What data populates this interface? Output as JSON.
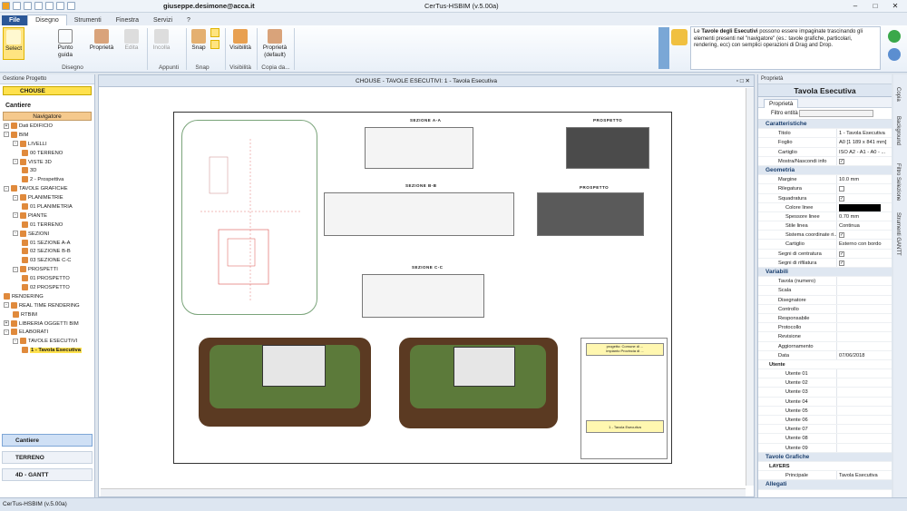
{
  "app": {
    "user": "giuseppe.desimone@acca.it",
    "title": "CerTus-HSBIM (v.5.00a)",
    "status": "CerTus-HSBIM (v.5.00a)"
  },
  "tabs": [
    "File",
    "Disegno",
    "Strumenti",
    "Finestra",
    "Servizi",
    "?"
  ],
  "ribbon": {
    "select": "Select",
    "punto": "Punto\nguida",
    "proprieta": "Proprietà",
    "edita": "Edita",
    "incolla": "Incolla",
    "snap": "Snap",
    "visibilita": "Visibilità",
    "prop_default": "Proprietà\n(default)",
    "groups": {
      "disegno": "Disegno",
      "appunti": "Appunti",
      "snap": "Snap",
      "visibilita": "Visibilità",
      "copia": "Copia da..."
    }
  },
  "help": {
    "pre": "Le ",
    "bold": "Tavole degli Esecutivi",
    "post": " possono essere impaginate trascinando gli elementi presenti nel \"navigatore\" (es.: tavole grafiche, particolari, rendering, ecc) con semplici operazioni di Drag and Drop."
  },
  "left": {
    "header": "Gestione Progetto",
    "project": "CHOUSE",
    "cantiere": "Cantiere",
    "navigatore": "Navigatore",
    "tree": [
      {
        "t": "Dati EDIFICIO",
        "l": 0,
        "g": "+"
      },
      {
        "t": "BIM",
        "l": 0,
        "g": "-"
      },
      {
        "t": "LIVELLI",
        "l": 1,
        "g": "-"
      },
      {
        "t": "00 TERRENO",
        "l": 2,
        "g": ""
      },
      {
        "t": "VISTE 3D",
        "l": 1,
        "g": "-"
      },
      {
        "t": "3D",
        "l": 2,
        "g": ""
      },
      {
        "t": "2 - Prospettiva",
        "l": 2,
        "g": ""
      },
      {
        "t": "TAVOLE GRAFICHE",
        "l": 0,
        "g": "-"
      },
      {
        "t": "PLANIMETRIE",
        "l": 1,
        "g": "-"
      },
      {
        "t": "01 PLANIMETRIA",
        "l": 2,
        "g": ""
      },
      {
        "t": "PIANTE",
        "l": 1,
        "g": "-"
      },
      {
        "t": "01 TERRENO",
        "l": 2,
        "g": ""
      },
      {
        "t": "SEZIONI",
        "l": 1,
        "g": "-"
      },
      {
        "t": "01 SEZIONE  A-A",
        "l": 2,
        "g": ""
      },
      {
        "t": "02 SEZIONE  B-B",
        "l": 2,
        "g": ""
      },
      {
        "t": "03 SEZIONE  C-C",
        "l": 2,
        "g": ""
      },
      {
        "t": "PROSPETTI",
        "l": 1,
        "g": "-"
      },
      {
        "t": "01 PROSPETTO",
        "l": 2,
        "g": ""
      },
      {
        "t": "02 PROSPETTO",
        "l": 2,
        "g": ""
      },
      {
        "t": "RENDERING",
        "l": 0,
        "g": ""
      },
      {
        "t": "REAL TIME RENDERING",
        "l": 0,
        "g": "-"
      },
      {
        "t": "RTBIM",
        "l": 1,
        "g": ""
      },
      {
        "t": "LIBRERIA OGGETTI BIM",
        "l": 0,
        "g": "+"
      },
      {
        "t": "ELABORATI",
        "l": 0,
        "g": "-"
      },
      {
        "t": "TAVOLE ESECUTIVI",
        "l": 1,
        "g": "-"
      },
      {
        "t": "1 - Tavola Esecutiva",
        "l": 2,
        "g": "",
        "sel": true
      }
    ],
    "nav": [
      "Cantiere",
      "TERRENO",
      "4D - GANTT"
    ]
  },
  "doc": {
    "title": "CHOUSE - TAVOLE ESECUTIVI: 1 - Tavola Esecutiva",
    "labels": {
      "sa": "SEZIONE A-A",
      "sb": "SEZIONE B-B",
      "sc": "SEZIONE C-C",
      "p1": "PROSPETTO",
      "p2": "PROSPETTO"
    },
    "cartiglio": {
      "top": "progetto: Comune di ...\nimpianto Provincia di ...",
      "mid": "1 - Tavola Esecutiva"
    }
  },
  "props": {
    "header": "Proprietà",
    "title": "Tavola Esecutiva",
    "tab": "Proprietà",
    "filtro": "Filtro entità",
    "rows": [
      {
        "c": "cat",
        "k": "Caratteristiche"
      },
      {
        "k": "Titolo",
        "v": "1 - Tavola Esecutiva"
      },
      {
        "k": "Foglio",
        "v": "A0 [1 189 x 841 mm]"
      },
      {
        "k": "Cartiglio",
        "v": "ISO  A2 - A1 - A0 - ..."
      },
      {
        "k": "Mostra/Nascondi info",
        "cb": true
      },
      {
        "c": "cat",
        "k": "Geometria"
      },
      {
        "k": "Margine",
        "v": "10.0 mm"
      },
      {
        "k": "Rilegatura",
        "cb": false
      },
      {
        "k": "Squadratura",
        "cb": true,
        "c": "sub2"
      },
      {
        "c": "ind",
        "k": "Colore linee",
        "sw": true
      },
      {
        "c": "ind",
        "k": "Spessore linee",
        "v": "0.70 mm"
      },
      {
        "c": "ind",
        "k": "Stile linea",
        "v": "Continua"
      },
      {
        "c": "ind",
        "k": "Sistema coordinate ri...",
        "cb": true
      },
      {
        "c": "ind",
        "k": "Cartiglio",
        "v": "Esterno con bordo"
      },
      {
        "k": "Segni di centratura",
        "cb": true
      },
      {
        "k": "Segni di rifilatura",
        "cb": true
      },
      {
        "c": "cat",
        "k": "Variabili"
      },
      {
        "k": "Tavola (numero)",
        "v": ""
      },
      {
        "k": "Scala",
        "v": ""
      },
      {
        "k": "Disegnatore",
        "v": ""
      },
      {
        "k": "Controllo",
        "v": ""
      },
      {
        "k": "Responsabile",
        "v": ""
      },
      {
        "k": "Protocollo",
        "v": ""
      },
      {
        "k": "Revisione",
        "v": ""
      },
      {
        "k": "Aggiornamento",
        "v": ""
      },
      {
        "k": "Data",
        "v": "07/06/2018"
      },
      {
        "c": "sub",
        "k": "Utente"
      },
      {
        "c": "ind",
        "k": "Utente 01",
        "v": ""
      },
      {
        "c": "ind",
        "k": "Utente 02",
        "v": ""
      },
      {
        "c": "ind",
        "k": "Utente 03",
        "v": ""
      },
      {
        "c": "ind",
        "k": "Utente 04",
        "v": ""
      },
      {
        "c": "ind",
        "k": "Utente 05",
        "v": ""
      },
      {
        "c": "ind",
        "k": "Utente 06",
        "v": ""
      },
      {
        "c": "ind",
        "k": "Utente 07",
        "v": ""
      },
      {
        "c": "ind",
        "k": "Utente 08",
        "v": ""
      },
      {
        "c": "ind",
        "k": "Utente 09",
        "v": ""
      },
      {
        "c": "cat",
        "k": "Tavole Grafiche"
      },
      {
        "c": "sub",
        "k": "LAYERS"
      },
      {
        "c": "ind",
        "k": "Principale",
        "v": "Tavola Esecutiva"
      },
      {
        "c": "cat",
        "k": "Allegati"
      }
    ]
  },
  "side_tabs": [
    "Copia",
    "Background",
    "Filtro Selezione",
    "Strumenti GANTT"
  ],
  "colors": {
    "accent": "#2b5797",
    "selection": "#ffe14d",
    "navigatore": "#f5c98d"
  }
}
